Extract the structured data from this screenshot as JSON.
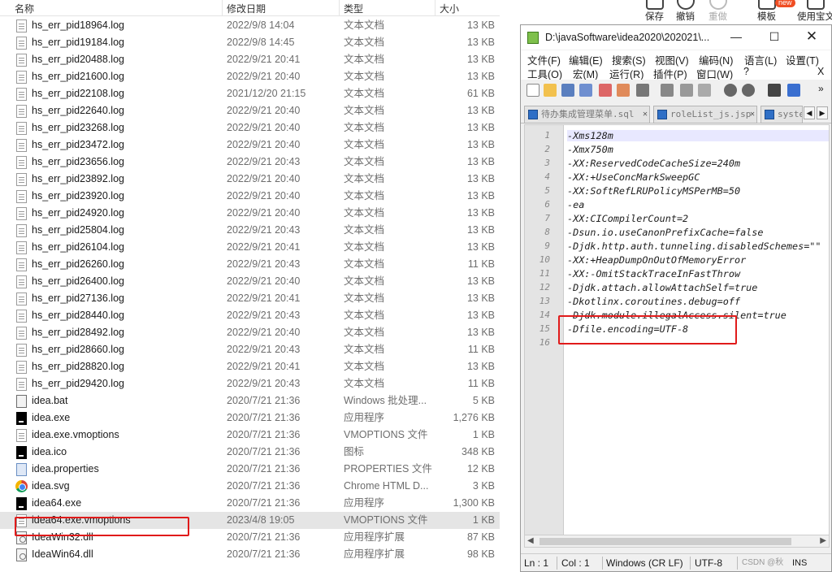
{
  "explorer": {
    "columns": {
      "name": "名称",
      "date": "修改日期",
      "type": "类型",
      "size": "大小"
    },
    "files": [
      {
        "name": "hs_err_pid18964.log",
        "date": "2022/9/8 14:04",
        "type": "文本文档",
        "size": "13 KB",
        "icon": "text-file-icon"
      },
      {
        "name": "hs_err_pid19184.log",
        "date": "2022/9/8 14:45",
        "type": "文本文档",
        "size": "13 KB",
        "icon": "text-file-icon"
      },
      {
        "name": "hs_err_pid20488.log",
        "date": "2022/9/21 20:41",
        "type": "文本文档",
        "size": "13 KB",
        "icon": "text-file-icon"
      },
      {
        "name": "hs_err_pid21600.log",
        "date": "2022/9/21 20:40",
        "type": "文本文档",
        "size": "13 KB",
        "icon": "text-file-icon"
      },
      {
        "name": "hs_err_pid22108.log",
        "date": "2021/12/20 21:15",
        "type": "文本文档",
        "size": "61 KB",
        "icon": "text-file-icon"
      },
      {
        "name": "hs_err_pid22640.log",
        "date": "2022/9/21 20:40",
        "type": "文本文档",
        "size": "13 KB",
        "icon": "text-file-icon"
      },
      {
        "name": "hs_err_pid23268.log",
        "date": "2022/9/21 20:40",
        "type": "文本文档",
        "size": "13 KB",
        "icon": "text-file-icon"
      },
      {
        "name": "hs_err_pid23472.log",
        "date": "2022/9/21 20:40",
        "type": "文本文档",
        "size": "13 KB",
        "icon": "text-file-icon"
      },
      {
        "name": "hs_err_pid23656.log",
        "date": "2022/9/21 20:43",
        "type": "文本文档",
        "size": "13 KB",
        "icon": "text-file-icon"
      },
      {
        "name": "hs_err_pid23892.log",
        "date": "2022/9/21 20:40",
        "type": "文本文档",
        "size": "13 KB",
        "icon": "text-file-icon"
      },
      {
        "name": "hs_err_pid23920.log",
        "date": "2022/9/21 20:40",
        "type": "文本文档",
        "size": "13 KB",
        "icon": "text-file-icon"
      },
      {
        "name": "hs_err_pid24920.log",
        "date": "2022/9/21 20:40",
        "type": "文本文档",
        "size": "13 KB",
        "icon": "text-file-icon"
      },
      {
        "name": "hs_err_pid25804.log",
        "date": "2022/9/21 20:43",
        "type": "文本文档",
        "size": "13 KB",
        "icon": "text-file-icon"
      },
      {
        "name": "hs_err_pid26104.log",
        "date": "2022/9/21 20:41",
        "type": "文本文档",
        "size": "13 KB",
        "icon": "text-file-icon"
      },
      {
        "name": "hs_err_pid26260.log",
        "date": "2022/9/21 20:43",
        "type": "文本文档",
        "size": "11 KB",
        "icon": "text-file-icon"
      },
      {
        "name": "hs_err_pid26400.log",
        "date": "2022/9/21 20:40",
        "type": "文本文档",
        "size": "13 KB",
        "icon": "text-file-icon"
      },
      {
        "name": "hs_err_pid27136.log",
        "date": "2022/9/21 20:41",
        "type": "文本文档",
        "size": "13 KB",
        "icon": "text-file-icon"
      },
      {
        "name": "hs_err_pid28440.log",
        "date": "2022/9/21 20:43",
        "type": "文本文档",
        "size": "13 KB",
        "icon": "text-file-icon"
      },
      {
        "name": "hs_err_pid28492.log",
        "date": "2022/9/21 20:40",
        "type": "文本文档",
        "size": "13 KB",
        "icon": "text-file-icon"
      },
      {
        "name": "hs_err_pid28660.log",
        "date": "2022/9/21 20:43",
        "type": "文本文档",
        "size": "11 KB",
        "icon": "text-file-icon"
      },
      {
        "name": "hs_err_pid28820.log",
        "date": "2022/9/21 20:41",
        "type": "文本文档",
        "size": "13 KB",
        "icon": "text-file-icon"
      },
      {
        "name": "hs_err_pid29420.log",
        "date": "2022/9/21 20:43",
        "type": "文本文档",
        "size": "11 KB",
        "icon": "text-file-icon"
      },
      {
        "name": "idea.bat",
        "date": "2020/7/21 21:36",
        "type": "Windows 批处理...",
        "size": "5 KB",
        "icon": "batch-file-icon"
      },
      {
        "name": "idea.exe",
        "date": "2020/7/21 21:36",
        "type": "应用程序",
        "size": "1,276 KB",
        "icon": "intellij-app-icon"
      },
      {
        "name": "idea.exe.vmoptions",
        "date": "2020/7/21 21:36",
        "type": "VMOPTIONS 文件",
        "size": "1 KB",
        "icon": "blank-file-icon"
      },
      {
        "name": "idea.ico",
        "date": "2020/7/21 21:36",
        "type": "图标",
        "size": "348 KB",
        "icon": "intellij-ico-icon"
      },
      {
        "name": "idea.properties",
        "date": "2020/7/21 21:36",
        "type": "PROPERTIES 文件",
        "size": "12 KB",
        "icon": "properties-file-icon"
      },
      {
        "name": "idea.svg",
        "date": "2020/7/21 21:36",
        "type": "Chrome HTML D...",
        "size": "3 KB",
        "icon": "chrome-icon"
      },
      {
        "name": "idea64.exe",
        "date": "2020/7/21 21:36",
        "type": "应用程序",
        "size": "1,300 KB",
        "icon": "intellij-app-icon"
      },
      {
        "name": "idea64.exe.vmoptions",
        "date": "2023/4/8 19:05",
        "type": "VMOPTIONS 文件",
        "size": "1 KB",
        "icon": "blank-file-icon",
        "selected": true
      },
      {
        "name": "IdeaWin32.dll",
        "date": "2020/7/21 21:36",
        "type": "应用程序扩展",
        "size": "87 KB",
        "icon": "dll-file-icon"
      },
      {
        "name": "IdeaWin64.dll",
        "date": "2020/7/21 21:36",
        "type": "应用程序扩展",
        "size": "98 KB",
        "icon": "dll-file-icon"
      }
    ]
  },
  "ribbon": {
    "items": [
      {
        "label": "保存",
        "icon": "save-icon",
        "badge": ""
      },
      {
        "label": "撤销",
        "icon": "undo-icon",
        "badge": ""
      },
      {
        "label": "重做",
        "icon": "redo-icon",
        "badge": ""
      },
      {
        "label": "模板",
        "icon": "template-icon",
        "badge": "new"
      },
      {
        "label": "使用宝文",
        "icon": "doc-icon",
        "badge": ""
      }
    ]
  },
  "notepad": {
    "title": "D:\\javaSoftware\\idea2020\\202021\\...",
    "menu_row1": [
      "文件(F)",
      "编辑(E)",
      "搜索(S)",
      "视图(V)",
      "编码(N)",
      "语言(L)",
      "设置(T)"
    ],
    "menu_row2": [
      "工具(O)",
      "宏(M)",
      "运行(R)",
      "插件(P)",
      "窗口(W)",
      "?"
    ],
    "close_x": "X",
    "tabs": [
      {
        "label": "待办集成管理菜单.sql",
        "active": false
      },
      {
        "label": "roleList_js.jsp",
        "active": false
      },
      {
        "label": "syste",
        "active": false
      }
    ],
    "lines": [
      "-Xms128m",
      "-Xmx750m",
      "-XX:ReservedCodeCacheSize=240m",
      "-XX:+UseConcMarkSweepGC",
      "-XX:SoftRefLRUPolicyMSPerMB=50",
      "-ea",
      "-XX:CICompilerCount=2",
      "-Dsun.io.useCanonPrefixCache=false",
      "-Djdk.http.auth.tunneling.disabledSchemes=\"\"",
      "-XX:+HeapDumpOnOutOfMemoryError",
      "-XX:-OmitStackTraceInFastThrow",
      "-Djdk.attach.allowAttachSelf=true",
      "-Dkotlinx.coroutines.debug=off",
      "-Djdk.module.illegalAccess.silent=true",
      "-Dfile.encoding=UTF-8",
      ""
    ],
    "line_numbers": [
      "1",
      "2",
      "3",
      "4",
      "5",
      "6",
      "7",
      "8",
      "9",
      "10",
      "11",
      "12",
      "13",
      "14",
      "15",
      "16"
    ],
    "status": {
      "ln": "Ln : 1",
      "col": "Col : 1",
      "eol": "Windows (CR LF)",
      "enc": "UTF-8",
      "watermark": "CSDN @秋",
      "ins": "INS"
    }
  },
  "colors": {
    "highlight": "#e01b1b",
    "selection": "#e5e5e5",
    "tab_accent": "#f6a600"
  }
}
